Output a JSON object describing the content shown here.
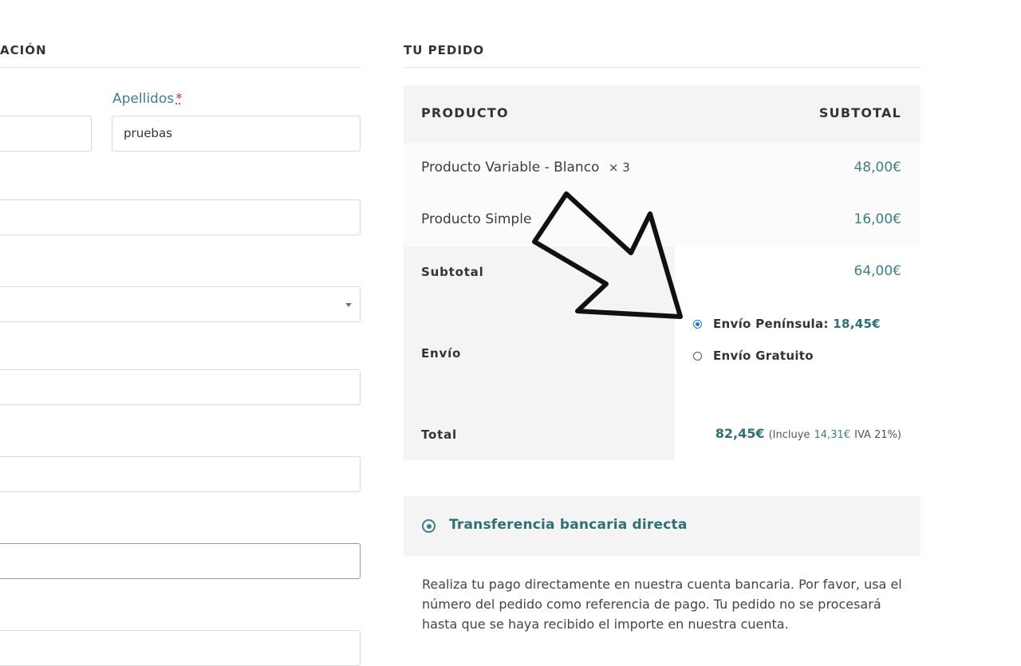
{
  "billing": {
    "heading": "ACIÓN",
    "apellidos_label": "Apellidos",
    "required_mark": "*",
    "apellidos_value": "pruebas"
  },
  "order": {
    "heading": "TU PEDIDO",
    "col_product": "PRODUCTO",
    "col_subtotal": "SUBTOTAL",
    "items": [
      {
        "name": "Producto Variable - Blanco",
        "qty": "× 3",
        "price": "48,00€"
      },
      {
        "name": "Producto Simple",
        "qty": "",
        "price": "16,00€"
      }
    ],
    "subtotal_label": "Subtotal",
    "subtotal_value": "64,00€",
    "shipping_label": "Envío",
    "shipping_options": [
      {
        "label": "Envío Península:",
        "price": "18,45€",
        "checked": true
      },
      {
        "label": "Envío Gratuito",
        "price": "",
        "checked": false
      }
    ],
    "total_label": "Total",
    "total_value": "82,45€",
    "total_note_prefix": "(Incluye",
    "total_note_tax": "14,31€",
    "total_note_suffix": "IVA 21%)"
  },
  "payment": {
    "method_label": "Transferencia bancaria directa",
    "description": "Realiza tu pago directamente en nuestra cuenta bancaria. Por favor, usa el número del pedido como referencia de pago. Tu pedido no se procesará hasta que se haya recibido el importe en nuestra cuenta."
  },
  "colors": {
    "accent": "#3f7f86",
    "accent_dark": "#2f6f78",
    "panel": "#f4f4f4"
  }
}
